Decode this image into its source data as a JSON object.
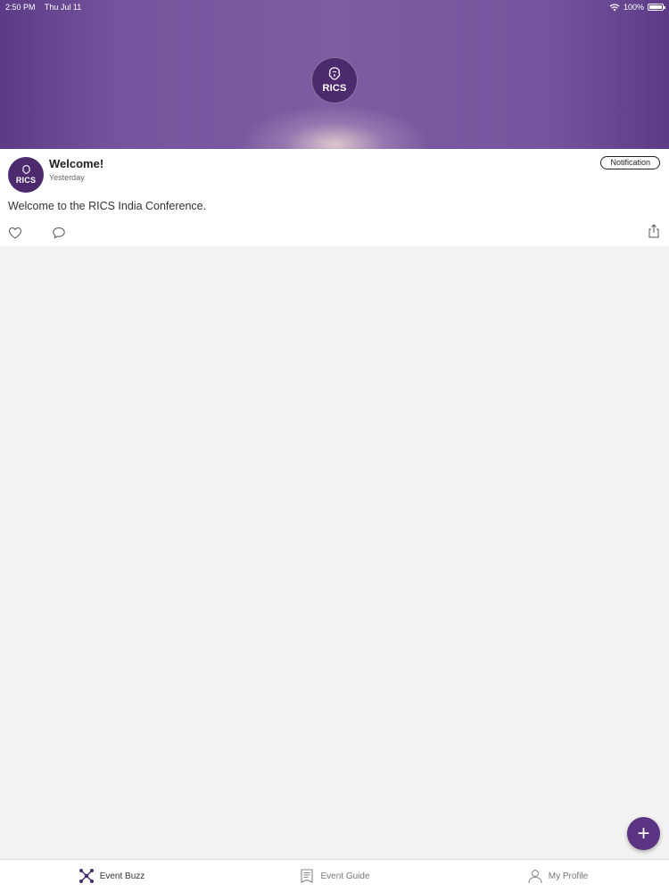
{
  "status_bar": {
    "time": "2:50 PM",
    "date": "Thu Jul 11",
    "battery": "100%",
    "battery_level": 1.0,
    "icons": [
      "wifi-icon",
      "battery-icon"
    ]
  },
  "header": {
    "logo_text": "RICS",
    "icon": "rics-lion-logo"
  },
  "post": {
    "avatar_text": "RICS",
    "title": "Welcome!",
    "time": "Yesterday",
    "tag": "Notification",
    "body": "Welcome to the RICS India Conference.",
    "actions": [
      "heart-icon",
      "comment-icon",
      "share-icon"
    ]
  },
  "fab": {
    "label": "+",
    "icon": "plus-icon"
  },
  "tabs": [
    {
      "label": "Event Buzz",
      "icon": "molecule-icon",
      "active": true
    },
    {
      "label": "Event Guide",
      "icon": "document-icon",
      "active": false
    },
    {
      "label": "My Profile",
      "icon": "user-icon",
      "active": false
    }
  ],
  "colors": {
    "brand": "#5a3382",
    "header_gradient": "#7d5ca3",
    "background": "#f3f2f2"
  }
}
